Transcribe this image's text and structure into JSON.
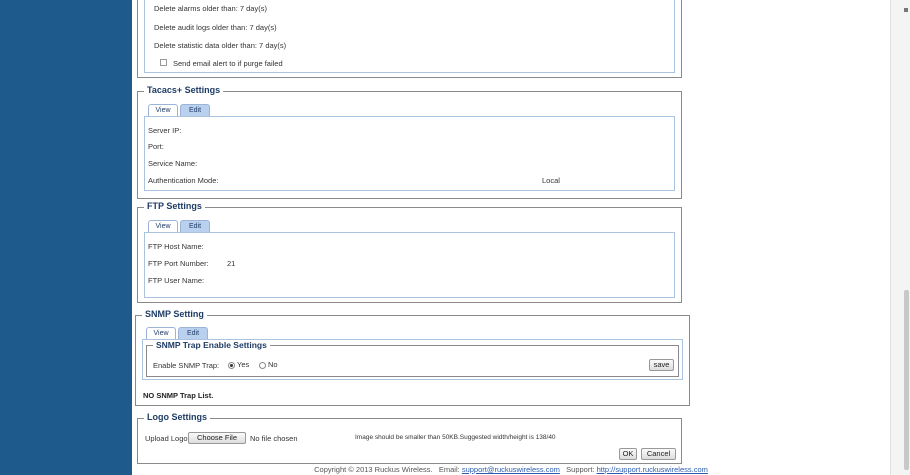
{
  "purge": {
    "alarms_label": "Delete alarms older than:  7 day(s)",
    "audit_label": "Delete audit logs older than:  7 day(s)",
    "stats_label": "Delete statistic data older than:  7 day(s)",
    "email_alert_label": "Send email alert to if purge failed"
  },
  "tacacs": {
    "title": "Tacacs+ Settings",
    "tab_view": "View",
    "tab_edit": "Edit",
    "server_ip_label": "Server IP:",
    "port_label": "Port:",
    "service_name_label": "Service Name:",
    "auth_mode_label": "Authentication Mode:",
    "auth_mode_value": "Local"
  },
  "ftp": {
    "title": "FTP Settings",
    "tab_view": "View",
    "tab_edit": "Edit",
    "host_label": "FTP Host Name:",
    "port_label": "FTP Port Number:",
    "port_value": "21",
    "user_label": "FTP User Name:"
  },
  "snmp": {
    "title": "SNMP Setting",
    "tab_view": "View",
    "tab_edit": "Edit",
    "trap_title": "SNMP Trap Enable Settings",
    "enable_label": "Enable SNMP Trap:",
    "yes_label": "Yes",
    "no_label": "No",
    "selected": "Yes",
    "save_label": "save",
    "no_trap_list": "NO SNMP Trap List."
  },
  "logo": {
    "title": "Logo Settings",
    "upload_label": "Upload Logo:",
    "choose_file_label": "Choose File",
    "no_file_label": "No file chosen",
    "hint": "Image should be smaller than 50KB.Suggested width/height is 138/40",
    "ok_label": "OK",
    "cancel_label": "Cancel"
  },
  "footer": {
    "copyright": "Copyright © 2013 Ruckus Wireless.",
    "email_label": "Email:",
    "email_value": "support@ruckuswireless.com",
    "support_label": "Support:",
    "support_value": "http://support.ruckuswireless.com"
  },
  "colors": {
    "sidebar": "#1f5a8c",
    "legend_text": "#1f3c66",
    "tab_active": "#b9d0ee",
    "link": "#2a5db0"
  }
}
